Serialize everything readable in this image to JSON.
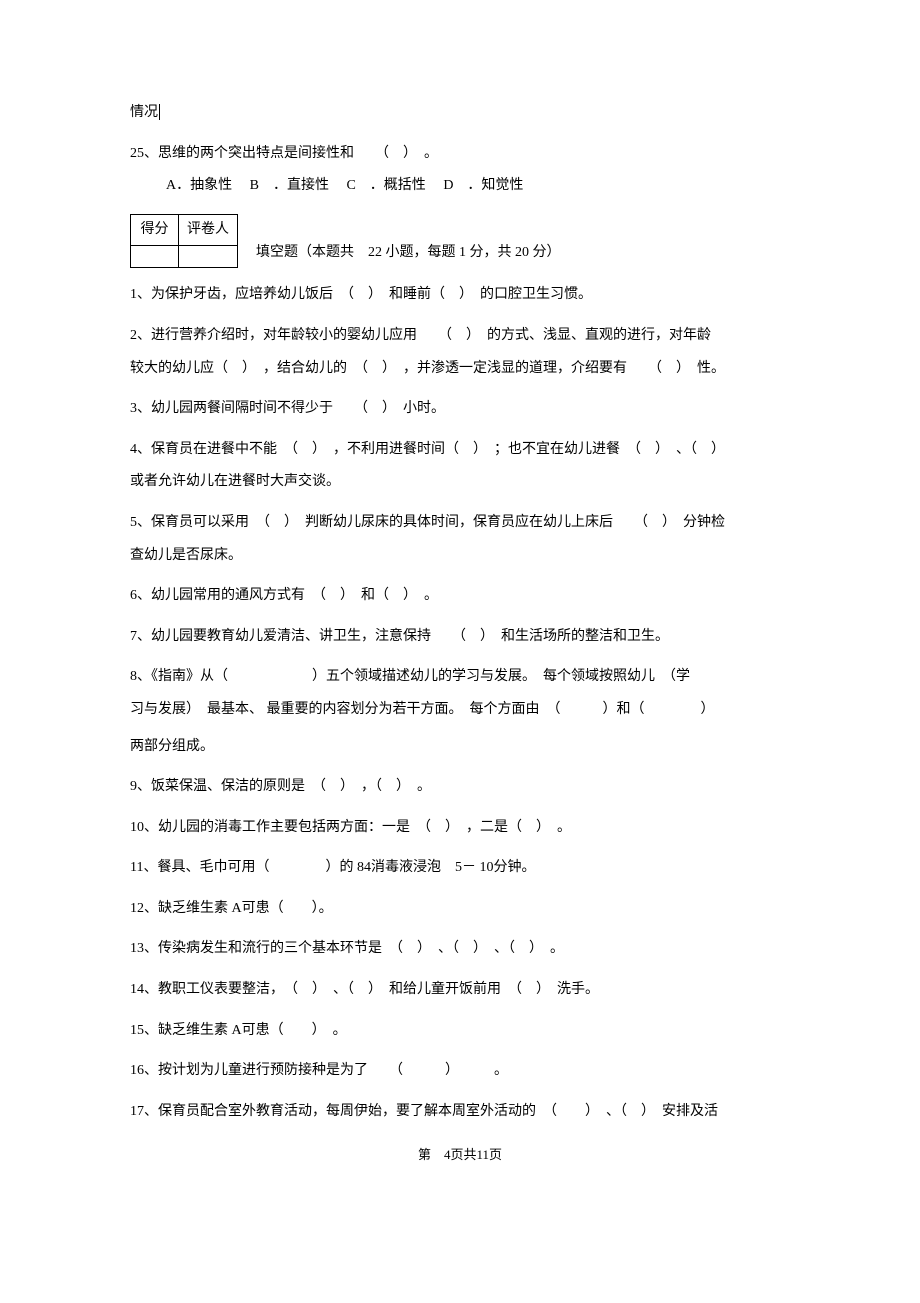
{
  "top_fragment": "情况",
  "q25": {
    "stem": "25、思维的两个突出特点是间接性和　　（　）　。",
    "opts": {
      "A": "A．抽象性",
      "B": "B　．直接性",
      "C": "C　．概括性",
      "D": "D　．知觉性"
    }
  },
  "score_table": {
    "score": "得分",
    "grader": "评卷人"
  },
  "section_title": "填空题（本题共　22 小题，每题 1 分，共 20 分）",
  "fills": {
    "f1": "1、为保护牙齿，应培养幼儿饭后　（　）　和睡前（　）　的口腔卫生习惯。",
    "f2a": "2、进行营养介绍时，对年龄较小的婴幼儿应用　　（　）　的方式、浅显、直观的进行，对年龄",
    "f2b": "较大的幼儿应（　）　，结合幼儿的　（　）　，并渗透一定浅显的道理，介绍要有　　（　）　性。",
    "f3": "3、幼儿园两餐间隔时间不得少于　　（　）　小时。",
    "f4a": "4、保育员在进餐中不能　（　）　，不利用进餐时间（　）　；也不宜在幼儿进餐　（　）　、（　）",
    "f4b": "或者允许幼儿在进餐时大声交谈。",
    "f5a": "5、保育员可以采用　（　）　判断幼儿尿床的具体时间，保育员应在幼儿上床后　　（　）　分钟检",
    "f5b": "查幼儿是否尿床。",
    "f6": "6、幼儿园常用的通风方式有　（　）　和（　）　。",
    "f7": "7、幼儿园要教育幼儿爱清洁、讲卫生，注意保持　　（　）　和生活场所的整洁和卫生。",
    "f8a": "8、《指南》从（　　　　　　）五个领域描述幼儿的学习与发展。　每个领域按照幼儿　（学",
    "f8b": "习与发展）　最基本、 最重要的内容划分为若干方面。　每个方面由　（　　　）和（　　　　）",
    "f8c": "两部分组成。",
    "f9": "9、饭菜保温、保洁的原则是　（　）　，（　）　。",
    "f10": "10、幼儿园的消毒工作主要包括两方面：一是　（　）　，二是（　）　。",
    "f11": "11、餐具、毛巾可用（　　　　）的 84消毒液浸泡　5－ 10分钟。",
    "f12": "12、缺乏维生素 A可患（　　）。",
    "f13": "13、传染病发生和流行的三个基本环节是　（　）　、（　）　、（　）　。",
    "f14": "14、教职工仪表要整洁，　（　）　、（　）　和给儿童开饭前用　（　）　洗手。",
    "f15": "15、缺乏维生素 A可患（　　）　。",
    "f16": "16、按计划为儿童进行预防接种是为了　　（　　　）　　　。",
    "f17": "17、保育员配合室外教育活动，每周伊始，要了解本周室外活动的　（　　）　、（　）　安排及活"
  },
  "footer": {
    "label_pre": "第　",
    "page": "4",
    "label_mid": "页共",
    "total": "11",
    "label_post": "页"
  }
}
